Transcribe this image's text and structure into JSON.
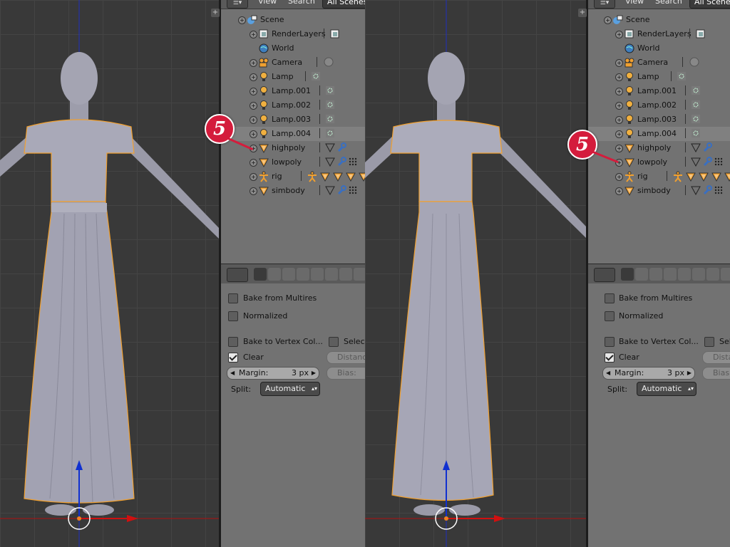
{
  "header": {
    "menu_icon": "editor-type-icon",
    "view": "View",
    "search": "Search",
    "scene_filter": "All Scenes"
  },
  "outliner": [
    {
      "label": "Scene",
      "icon": "scene-icon"
    },
    {
      "label": "RenderLayers",
      "icon": "render-layers-icon"
    },
    {
      "label": "World",
      "icon": "world-icon"
    },
    {
      "label": "Camera",
      "icon": "camera-icon"
    },
    {
      "label": "Lamp",
      "icon": "lamp-icon"
    },
    {
      "label": "Lamp.001",
      "icon": "lamp-icon"
    },
    {
      "label": "Lamp.002",
      "icon": "lamp-icon"
    },
    {
      "label": "Lamp.003",
      "icon": "lamp-icon"
    },
    {
      "label": "Lamp.004",
      "icon": "lamp-icon"
    },
    {
      "label": "highpoly",
      "icon": "mesh-icon"
    },
    {
      "label": "lowpoly",
      "icon": "mesh-icon"
    },
    {
      "label": "rig",
      "icon": "armature-icon"
    },
    {
      "label": "simbody",
      "icon": "mesh-icon"
    }
  ],
  "properties": {
    "bake_from_multires": "Bake from Multires",
    "normalized": "Normalized",
    "bake_to_vertex_color": "Bake to Vertex Col...",
    "selected": "Select",
    "selected_right": "Selec",
    "clear": "Clear",
    "distance": "Distanc",
    "margin_label": "Margin:",
    "margin_value": "3 px",
    "bias": "Bias:",
    "split_label": "Split:",
    "split_value": "Automatic"
  },
  "callouts": {
    "left": "5",
    "right": "5"
  },
  "colors": {
    "background": "#3d3d3d",
    "panel": "#727272",
    "badge": "#d41c3c",
    "selection_outline": "#f0a030",
    "axis_x": "#d01010",
    "axis_z": "#1030d0"
  }
}
